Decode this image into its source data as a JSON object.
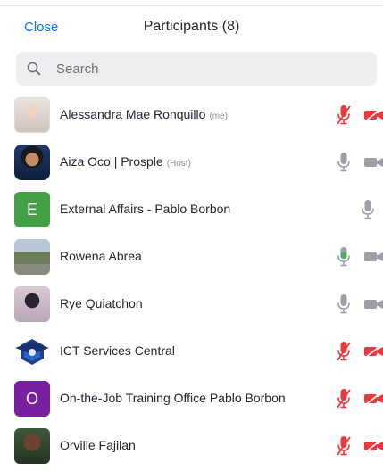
{
  "header": {
    "close_label": "Close",
    "title": "Participants (8)"
  },
  "search": {
    "placeholder": "Search"
  },
  "participants": [
    {
      "name": "Alessandra Mae Ronquillo",
      "role": "(me)",
      "avatar": "photo",
      "mic": "muted",
      "video": "off"
    },
    {
      "name": "Aiza Oco | Prosple",
      "role": "(Host)",
      "avatar": "photo",
      "mic": "unmuted",
      "video": "on"
    },
    {
      "name": "External Affairs - Pablo Borbon",
      "role": "",
      "avatar": "letter",
      "letter": "E",
      "avatar_color": "#43a047",
      "mic": "unmuted",
      "video": "none"
    },
    {
      "name": "Rowena Abrea",
      "role": "",
      "avatar": "photo",
      "mic": "speaking",
      "video": "on"
    },
    {
      "name": "Rye Quiatchon",
      "role": "",
      "avatar": "photo",
      "mic": "unmuted",
      "video": "on"
    },
    {
      "name": "ICT Services Central",
      "role": "",
      "avatar": "logo",
      "mic": "muted",
      "video": "off"
    },
    {
      "name": "On-the-Job Training Office Pablo Borbon",
      "role": "",
      "avatar": "letter",
      "letter": "O",
      "avatar_color": "#7b1fa2",
      "mic": "muted",
      "video": "off"
    },
    {
      "name": "Orville Fajilan",
      "role": "",
      "avatar": "photo",
      "mic": "muted",
      "video": "off"
    }
  ],
  "colors": {
    "accent": "#0e72ed",
    "muted_red": "#e8393f",
    "speaking_green": "#4caf50",
    "icon_gray": "#9e9ea7"
  }
}
